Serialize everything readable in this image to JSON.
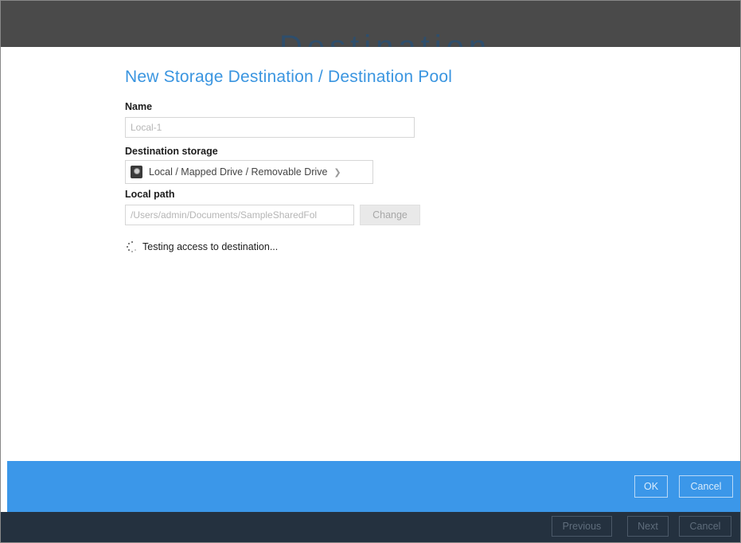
{
  "background": {
    "title": "Destination",
    "strip_color": "#4a4a4a"
  },
  "dialog": {
    "title": "New Storage Destination / Destination Pool",
    "name_label": "Name",
    "name_value": "Local-1",
    "destination_storage_label": "Destination storage",
    "destination_storage_value": "Local / Mapped Drive / Removable Drive",
    "destination_storage_icon": "hard-drive-icon",
    "local_path_label": "Local path",
    "local_path_value": "/Users/admin/Documents/SampleSharedFol",
    "change_label": "Change",
    "status_text": "Testing access to destination...",
    "status_icon": "loading-spinner-icon"
  },
  "action_bar": {
    "color": "#3b97e9",
    "ok_label": "OK",
    "cancel_label": "Cancel"
  },
  "footer": {
    "color": "#24313f",
    "previous_label": "Previous",
    "next_label": "Next",
    "cancel_label": "Cancel"
  },
  "accent_color": "#3a95e0"
}
